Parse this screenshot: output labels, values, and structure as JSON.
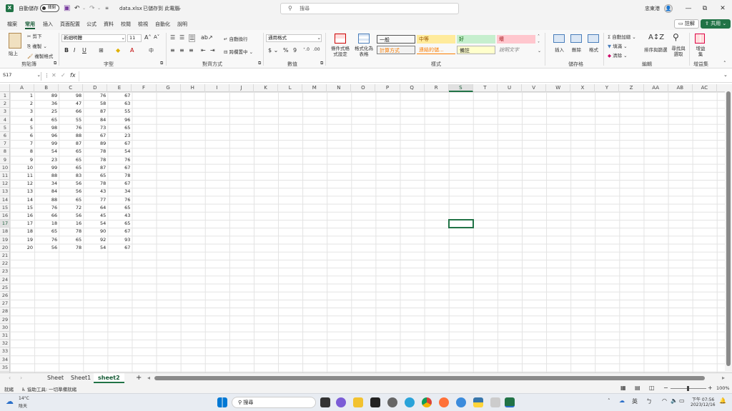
{
  "titlebar": {
    "autosave_label": "自動儲存",
    "autosave_state": "關閉",
    "filename": "data.xlsx",
    "save_status": "已儲存到 此電腦",
    "search_placeholder": "搜尋",
    "user_name": "忠東港",
    "colors": {
      "accent": "#217346",
      "title_bg": "#f3f3f3"
    }
  },
  "menu": {
    "tabs": [
      "檔案",
      "常用",
      "插入",
      "頁面配置",
      "公式",
      "資料",
      "校閱",
      "檢視",
      "自動化",
      "說明"
    ],
    "active_tab": "常用",
    "comment_button": "註解",
    "share_button": "共用"
  },
  "ribbon": {
    "clipboard": {
      "label": "剪貼簿",
      "paste": "貼上",
      "cut": "剪下",
      "copy": "複製",
      "format_painter": "複製格式"
    },
    "font": {
      "label": "字型",
      "font_name": "新細明體",
      "font_size": "11"
    },
    "alignment": {
      "label": "對齊方式",
      "wrap": "自動換行",
      "merge": "跨欄置中"
    },
    "number": {
      "label": "數值",
      "format": "通用格式"
    },
    "styles": {
      "label": "樣式",
      "conditional": "條件式格式設定",
      "as_table": "格式化為表格",
      "cells": [
        {
          "text": "一般",
          "bg": "#ffffff",
          "fg": "#222222"
        },
        {
          "text": "中等",
          "bg": "#ffeb9c",
          "fg": "#9c5700"
        },
        {
          "text": "好",
          "bg": "#c6efce",
          "fg": "#006100"
        },
        {
          "text": "壞",
          "bg": "#ffc7ce",
          "fg": "#9c0006"
        },
        {
          "text": "計算方式",
          "bg": "#f2f2f2",
          "fg": "#fa7d00"
        },
        {
          "text": "連結的儲...",
          "bg": "#ffffff",
          "fg": "#fa7d00"
        },
        {
          "text": "備註",
          "bg": "#ffffcc",
          "fg": "#222222"
        },
        {
          "text": "說明文字",
          "bg": "#ffffff",
          "fg": "#7f7f7f"
        }
      ]
    },
    "cells_group": {
      "label": "儲存格",
      "insert": "插入",
      "delete": "刪除",
      "format": "格式"
    },
    "editing": {
      "label": "編輯",
      "autosum": "自動加總",
      "fill": "填滿",
      "clear": "清除",
      "sort": "排序與篩選",
      "find": "尋找與選取"
    },
    "addins": {
      "label": "增益集",
      "button": "增益集"
    }
  },
  "formula_bar": {
    "name_box": "S17",
    "fx": "fx",
    "content": ""
  },
  "grid": {
    "columns": [
      "A",
      "B",
      "C",
      "D",
      "E",
      "F",
      "G",
      "H",
      "I",
      "J",
      "K",
      "L",
      "M",
      "N",
      "O",
      "P",
      "Q",
      "R",
      "S",
      "T",
      "U",
      "V",
      "W",
      "X",
      "Y",
      "Z",
      "AA",
      "AB",
      "AC"
    ],
    "selected_column": "S",
    "selected_row": 17,
    "row_count": 35,
    "data": [
      [
        1,
        89,
        98,
        76,
        67
      ],
      [
        2,
        36,
        47,
        58,
        63
      ],
      [
        3,
        25,
        66,
        87,
        55
      ],
      [
        4,
        65,
        55,
        84,
        96
      ],
      [
        5,
        98,
        76,
        73,
        65
      ],
      [
        6,
        96,
        88,
        67,
        23
      ],
      [
        7,
        99,
        87,
        89,
        67
      ],
      [
        8,
        54,
        65,
        78,
        54
      ],
      [
        9,
        23,
        65,
        78,
        76
      ],
      [
        10,
        99,
        65,
        87,
        67
      ],
      [
        11,
        88,
        83,
        65,
        78
      ],
      [
        12,
        34,
        56,
        78,
        67
      ],
      [
        13,
        84,
        56,
        43,
        34
      ],
      [
        14,
        88,
        65,
        77,
        76
      ],
      [
        15,
        76,
        72,
        64,
        65
      ],
      [
        16,
        66,
        56,
        45,
        43
      ],
      [
        17,
        18,
        16,
        54,
        65
      ],
      [
        18,
        65,
        78,
        90,
        67
      ],
      [
        19,
        76,
        65,
        92,
        93
      ],
      [
        20,
        56,
        78,
        54,
        67
      ]
    ]
  },
  "sheets": {
    "tabs": [
      "Sheet",
      "Sheet1",
      "sheet2"
    ],
    "active": "sheet2"
  },
  "status": {
    "ready": "就緒",
    "accessibility": "協助工具: 一切準備就緒",
    "zoom": "100%"
  },
  "taskbar": {
    "weather_temp": "14°C",
    "weather_desc": "陰天",
    "search": "搜尋",
    "lang": "英",
    "time": "下午 07:56",
    "date": "2023/12/16"
  }
}
